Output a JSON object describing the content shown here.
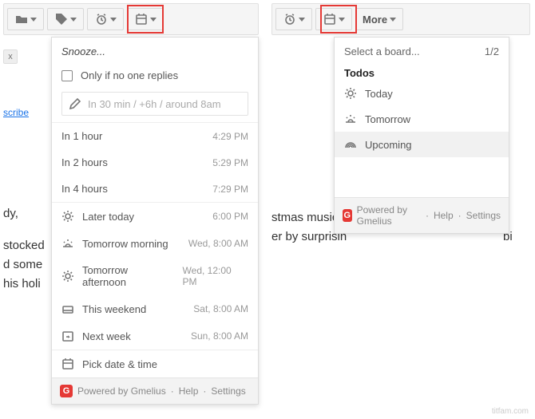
{
  "left": {
    "snooze_header": "Snooze...",
    "only_if_no_reply": "Only if no one replies",
    "custom_placeholder": "In 30 min / +6h / around 8am",
    "quick": [
      {
        "label": "In 1 hour",
        "time": "4:29 PM"
      },
      {
        "label": "In 2 hours",
        "time": "5:29 PM"
      },
      {
        "label": "In 4 hours",
        "time": "7:29 PM"
      }
    ],
    "preset": [
      {
        "label": "Later today",
        "time": "6:00 PM"
      },
      {
        "label": "Tomorrow morning",
        "time": "Wed, 8:00 AM"
      },
      {
        "label": "Tomorrow afternoon",
        "time": "Wed, 12:00 PM"
      },
      {
        "label": "This weekend",
        "time": "Sat, 8:00 AM"
      },
      {
        "label": "Next week",
        "time": "Sun, 8:00 AM"
      }
    ],
    "pick_label": "Pick date & time"
  },
  "right": {
    "more_label": "More",
    "select_board": "Select a board...",
    "pager": "1/2",
    "group": "Todos",
    "items": [
      {
        "label": "Today"
      },
      {
        "label": "Tomorrow"
      },
      {
        "label": "Upcoming"
      }
    ]
  },
  "footer": {
    "powered": "Powered by Gmelius",
    "help": "Help",
    "settings": "Settings",
    "dot": "·",
    "badge": "G"
  },
  "bg": {
    "unsubscribe": "scribe",
    "chip_x": "x",
    "l1": "dy,",
    "l2": "stocked",
    "l3": "d some",
    "l4": "his holi",
    "r1": "stmas music",
    "r2": "er by surprisin",
    "r3": "bi"
  },
  "watermark": "titfam.com"
}
